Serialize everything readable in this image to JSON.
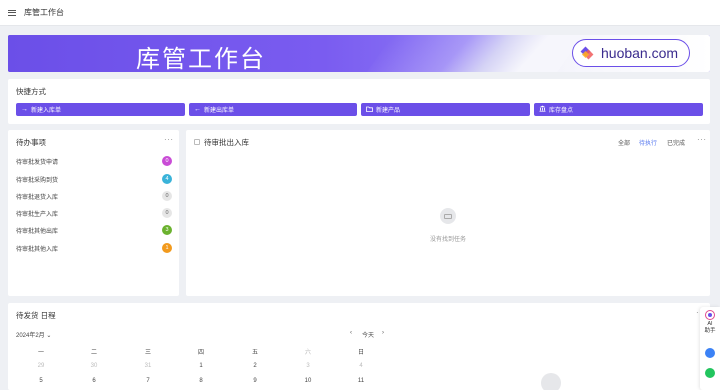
{
  "topbar": {
    "title": "库管工作台"
  },
  "banner": {
    "title": "库管工作台",
    "brand": "huoban.com"
  },
  "shortcuts": {
    "title": "快捷方式",
    "buttons": [
      {
        "label": "新建入库单",
        "icon": "arrow-right-icon"
      },
      {
        "label": "新建出库单",
        "icon": "arrow-left-icon"
      },
      {
        "label": "新建产品",
        "icon": "folder-icon"
      },
      {
        "label": "库存盘点",
        "icon": "bank-icon"
      }
    ]
  },
  "todo": {
    "title": "待办事项",
    "more": "···",
    "items": [
      {
        "label": "待审批发货申请",
        "count": "0",
        "color": "#c94cd6"
      },
      {
        "label": "待审批采购到货",
        "count": "4",
        "color": "#3ab3d9"
      },
      {
        "label": "待审批退货入库",
        "count": "0",
        "color": "#e6e6e6"
      },
      {
        "label": "待审批生产入库",
        "count": "0",
        "color": "#e6e6e6"
      },
      {
        "label": "待审批其他出库",
        "count": "3",
        "color": "#6bb22f"
      },
      {
        "label": "待审批其他入库",
        "count": "1",
        "color": "#f29a1d"
      }
    ]
  },
  "approval": {
    "title": "待审批出入库",
    "filters": [
      {
        "label": "全部"
      },
      {
        "label": "待执行"
      },
      {
        "label": "已完成"
      }
    ],
    "more": "···",
    "empty": "没有找到任务"
  },
  "calendar": {
    "title": "待发货 日程",
    "month": "2024年2月",
    "chevron": "⌄",
    "prev": "‹",
    "today": "今天",
    "next": "›",
    "more": "···",
    "weekdays": [
      "一",
      "二",
      "三",
      "四",
      "五",
      "六",
      "日"
    ],
    "rows": [
      [
        "29",
        "30",
        "31",
        "1",
        "2",
        "3",
        "4"
      ],
      [
        "5",
        "6",
        "7",
        "8",
        "9",
        "10",
        "11"
      ]
    ]
  },
  "floatbar": {
    "ai": "AI 助手"
  }
}
